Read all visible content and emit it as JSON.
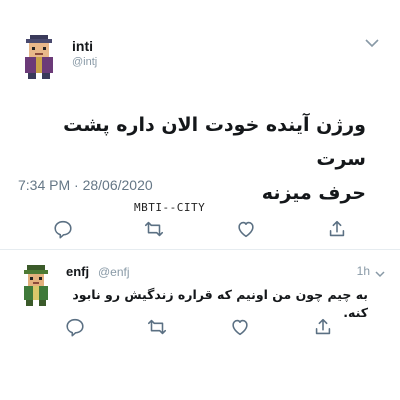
{
  "main_tweet": {
    "author_name": "inti",
    "author_handle": "@intj",
    "text_line1": "ورژن آینده خودت الان داره پشت سرت",
    "text_line2": "حرف میزنه",
    "timestamp": "7:34 PM · 28/06/2020",
    "watermark": "MBTI--CITY",
    "avatar_icon": "pixel-character-avatar-icon",
    "menu_icon": "chevron-down-icon"
  },
  "reply_tweet": {
    "author_name": "enfj",
    "author_handle": "@enfj",
    "age": "1h",
    "text": "به چیم چون من اونیم که قراره زندگیش رو نابود کنه.",
    "avatar_icon": "pixel-character-avatar-icon",
    "menu_icon": "chevron-down-icon"
  },
  "actions": [
    {
      "icon": "reply-icon"
    },
    {
      "icon": "retweet-icon"
    },
    {
      "icon": "like-icon"
    },
    {
      "icon": "share-icon"
    }
  ],
  "colors": {
    "icon": "#5b7083",
    "divider": "#e6ecf0",
    "secondary_text": "#657786"
  }
}
